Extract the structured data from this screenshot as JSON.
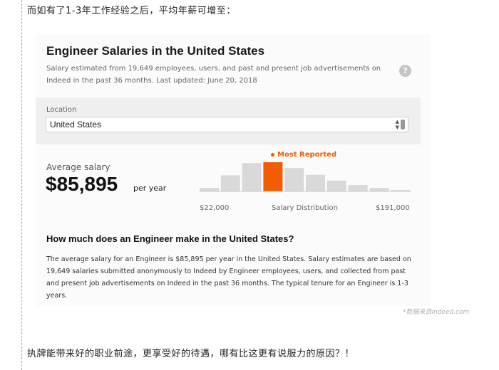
{
  "article": {
    "intro_text": "而如有了1-3年工作经验之后，平均年薪可增至：",
    "outro_text": "执牌能带来好的职业前途，更享受好的待遇，哪有比这更有说服力的原因？！",
    "watermark": "*数据来自indeed.com"
  },
  "card": {
    "title": "Engineer Salaries in the United States",
    "subtitle": "Salary estimated from 19,649 employees, users, and past and present job advertisements on Indeed in the past 36 months. Last updated: June 20, 2018",
    "help_icon": "question-circle-icon",
    "help_glyph": "?"
  },
  "location": {
    "label": "Location",
    "selected": "United States"
  },
  "salary": {
    "average_label": "Average salary",
    "average_value": "$85,895",
    "period": "per year"
  },
  "chart_data": {
    "type": "bar",
    "annotation": "Most Reported",
    "highlight_index": 3,
    "values": [
      0.12,
      0.55,
      0.97,
      1.0,
      0.8,
      0.57,
      0.37,
      0.22,
      0.12,
      0.05
    ],
    "xlabel": "Salary Distribution",
    "x_min_label": "$22,000",
    "x_max_label": "$191,000",
    "colors": {
      "bar": "#d9d9d9",
      "highlight": "#f25c05",
      "baseline": "#cccccc"
    }
  },
  "info": {
    "heading": "How much does an Engineer make in the United States?",
    "body": "The average salary for an Engineer is $85,895 per year in the United States. Salary estimates are based on 19,649 salaries submitted anonymously to Indeed by Engineer employees, users, and collected from past and present job advertisements on Indeed in the past 36 months. The typical tenure for an Engineer is 1-3 years."
  }
}
